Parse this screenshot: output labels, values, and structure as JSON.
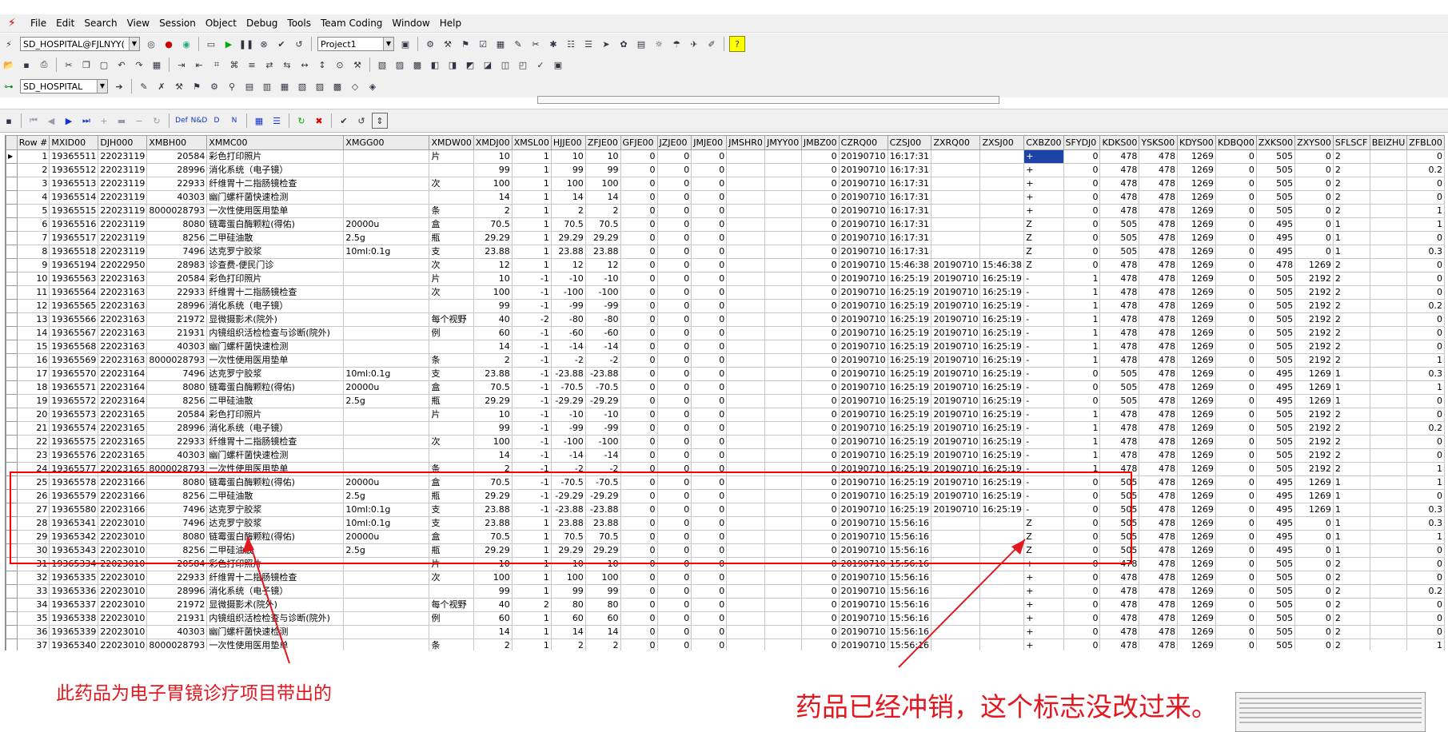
{
  "menu": [
    "File",
    "Edit",
    "Search",
    "View",
    "Session",
    "Object",
    "Debug",
    "Tools",
    "Team Coding",
    "Window",
    "Help"
  ],
  "toolbar": {
    "connection": "SD_HOSPITAL@FJLNYY(",
    "project": "Project1",
    "schema": "SD_HOSPITAL"
  },
  "grid": {
    "columns": [
      "Row #",
      "MXID00",
      "DJH000",
      "XMBH00",
      "XMMC00",
      "XMGG00",
      "XMDW00",
      "XMDJ00",
      "XMSL00",
      "HJJE00",
      "ZFJE00",
      "GFJE00",
      "JZJE00",
      "JMJE00",
      "JMSHR0",
      "JMYY00",
      "JMBZ00",
      "CZRQ00",
      "CZSJ00",
      "ZXRQ00",
      "ZXSJ00",
      "CXBZ00",
      "SFYDJ0",
      "KDKS00",
      "YSKS00",
      "KDYS00",
      "KDBQ00",
      "ZXKS00",
      "ZXYS00",
      "SFLSCF",
      "BEIZHU",
      "ZFBL00"
    ],
    "rows": [
      [
        "1",
        "19365511",
        "22023119",
        "20584",
        "彩色打印照片",
        "",
        "片",
        "10",
        "1",
        "10",
        "10",
        "0",
        "0",
        "0",
        "",
        "",
        "0",
        "20190710",
        "16:17:31",
        "",
        "",
        "+",
        "0",
        "478",
        "478",
        "1269",
        "0",
        "505",
        "0",
        "2",
        "",
        "0"
      ],
      [
        "2",
        "19365512",
        "22023119",
        "28996",
        "消化系统（电子镜）",
        "",
        "",
        "99",
        "1",
        "99",
        "99",
        "0",
        "0",
        "0",
        "",
        "",
        "0",
        "20190710",
        "16:17:31",
        "",
        "",
        "+",
        "0",
        "478",
        "478",
        "1269",
        "0",
        "505",
        "0",
        "2",
        "",
        "0.2"
      ],
      [
        "3",
        "19365513",
        "22023119",
        "22933",
        "纤维胃十二指肠镜检查",
        "",
        "次",
        "100",
        "1",
        "100",
        "100",
        "0",
        "0",
        "0",
        "",
        "",
        "0",
        "20190710",
        "16:17:31",
        "",
        "",
        "+",
        "0",
        "478",
        "478",
        "1269",
        "0",
        "505",
        "0",
        "2",
        "",
        "0"
      ],
      [
        "4",
        "19365514",
        "22023119",
        "40303",
        "幽门螺杆菌快速检测",
        "",
        "",
        "14",
        "1",
        "14",
        "14",
        "0",
        "0",
        "0",
        "",
        "",
        "0",
        "20190710",
        "16:17:31",
        "",
        "",
        "+",
        "0",
        "478",
        "478",
        "1269",
        "0",
        "505",
        "0",
        "2",
        "",
        "0"
      ],
      [
        "5",
        "19365515",
        "22023119",
        "8000028793",
        "一次性使用医用垫单",
        "",
        "条",
        "2",
        "1",
        "2",
        "2",
        "0",
        "0",
        "0",
        "",
        "",
        "0",
        "20190710",
        "16:17:31",
        "",
        "",
        "+",
        "0",
        "478",
        "478",
        "1269",
        "0",
        "505",
        "0",
        "2",
        "",
        "1"
      ],
      [
        "6",
        "19365516",
        "22023119",
        "8080",
        "链霉蛋白酶颗粒(得佑)",
        "20000u",
        "盒",
        "70.5",
        "1",
        "70.5",
        "70.5",
        "0",
        "0",
        "0",
        "",
        "",
        "0",
        "20190710",
        "16:17:31",
        "",
        "",
        "Z",
        "0",
        "505",
        "478",
        "1269",
        "0",
        "495",
        "0",
        "1",
        "",
        "1"
      ],
      [
        "7",
        "19365517",
        "22023119",
        "8256",
        "二甲硅油散",
        "2.5g",
        "瓶",
        "29.29",
        "1",
        "29.29",
        "29.29",
        "0",
        "0",
        "0",
        "",
        "",
        "0",
        "20190710",
        "16:17:31",
        "",
        "",
        "Z",
        "0",
        "505",
        "478",
        "1269",
        "0",
        "495",
        "0",
        "1",
        "",
        "0"
      ],
      [
        "8",
        "19365518",
        "22023119",
        "7496",
        "达克罗宁胶浆",
        "10ml:0.1g",
        "支",
        "23.88",
        "1",
        "23.88",
        "23.88",
        "0",
        "0",
        "0",
        "",
        "",
        "0",
        "20190710",
        "16:17:31",
        "",
        "",
        "Z",
        "0",
        "505",
        "478",
        "1269",
        "0",
        "495",
        "0",
        "1",
        "",
        "0.3"
      ],
      [
        "9",
        "19365194",
        "22022950",
        "28983",
        "诊查费-便民门诊",
        "",
        "次",
        "12",
        "1",
        "12",
        "12",
        "0",
        "0",
        "0",
        "",
        "",
        "0",
        "20190710",
        "15:46:38",
        "20190710",
        "15:46:38",
        "Z",
        "0",
        "478",
        "478",
        "1269",
        "0",
        "478",
        "1269",
        "2",
        "",
        "0"
      ],
      [
        "10",
        "19365563",
        "22023163",
        "20584",
        "彩色打印照片",
        "",
        "片",
        "10",
        "-1",
        "-10",
        "-10",
        "0",
        "0",
        "0",
        "",
        "",
        "0",
        "20190710",
        "16:25:19",
        "20190710",
        "16:25:19",
        "-",
        "1",
        "478",
        "478",
        "1269",
        "0",
        "505",
        "2192",
        "2",
        "",
        "0"
      ],
      [
        "11",
        "19365564",
        "22023163",
        "22933",
        "纤维胃十二指肠镜检查",
        "",
        "次",
        "100",
        "-1",
        "-100",
        "-100",
        "0",
        "0",
        "0",
        "",
        "",
        "0",
        "20190710",
        "16:25:19",
        "20190710",
        "16:25:19",
        "-",
        "1",
        "478",
        "478",
        "1269",
        "0",
        "505",
        "2192",
        "2",
        "",
        "0"
      ],
      [
        "12",
        "19365565",
        "22023163",
        "28996",
        "消化系统（电子镜）",
        "",
        "",
        "99",
        "-1",
        "-99",
        "-99",
        "0",
        "0",
        "0",
        "",
        "",
        "0",
        "20190710",
        "16:25:19",
        "20190710",
        "16:25:19",
        "-",
        "1",
        "478",
        "478",
        "1269",
        "0",
        "505",
        "2192",
        "2",
        "",
        "0.2"
      ],
      [
        "13",
        "19365566",
        "22023163",
        "21972",
        "显微摄影术(院外)",
        "",
        "每个视野",
        "40",
        "-2",
        "-80",
        "-80",
        "0",
        "0",
        "0",
        "",
        "",
        "0",
        "20190710",
        "16:25:19",
        "20190710",
        "16:25:19",
        "-",
        "1",
        "478",
        "478",
        "1269",
        "0",
        "505",
        "2192",
        "2",
        "",
        "0"
      ],
      [
        "14",
        "19365567",
        "22023163",
        "21931",
        "内镜组织活检检查与诊断(院外)",
        "",
        "例",
        "60",
        "-1",
        "-60",
        "-60",
        "0",
        "0",
        "0",
        "",
        "",
        "0",
        "20190710",
        "16:25:19",
        "20190710",
        "16:25:19",
        "-",
        "1",
        "478",
        "478",
        "1269",
        "0",
        "505",
        "2192",
        "2",
        "",
        "0"
      ],
      [
        "15",
        "19365568",
        "22023163",
        "40303",
        "幽门螺杆菌快速检测",
        "",
        "",
        "14",
        "-1",
        "-14",
        "-14",
        "0",
        "0",
        "0",
        "",
        "",
        "0",
        "20190710",
        "16:25:19",
        "20190710",
        "16:25:19",
        "-",
        "1",
        "478",
        "478",
        "1269",
        "0",
        "505",
        "2192",
        "2",
        "",
        "0"
      ],
      [
        "16",
        "19365569",
        "22023163",
        "8000028793",
        "一次性使用医用垫单",
        "",
        "条",
        "2",
        "-1",
        "-2",
        "-2",
        "0",
        "0",
        "0",
        "",
        "",
        "0",
        "20190710",
        "16:25:19",
        "20190710",
        "16:25:19",
        "-",
        "1",
        "478",
        "478",
        "1269",
        "0",
        "505",
        "2192",
        "2",
        "",
        "1"
      ],
      [
        "17",
        "19365570",
        "22023164",
        "7496",
        "达克罗宁胶浆",
        "10ml:0.1g",
        "支",
        "23.88",
        "-1",
        "-23.88",
        "-23.88",
        "0",
        "0",
        "0",
        "",
        "",
        "0",
        "20190710",
        "16:25:19",
        "20190710",
        "16:25:19",
        "-",
        "0",
        "505",
        "478",
        "1269",
        "0",
        "495",
        "1269",
        "1",
        "",
        "0.3"
      ],
      [
        "18",
        "19365571",
        "22023164",
        "8080",
        "链霉蛋白酶颗粒(得佑)",
        "20000u",
        "盒",
        "70.5",
        "-1",
        "-70.5",
        "-70.5",
        "0",
        "0",
        "0",
        "",
        "",
        "0",
        "20190710",
        "16:25:19",
        "20190710",
        "16:25:19",
        "-",
        "0",
        "505",
        "478",
        "1269",
        "0",
        "495",
        "1269",
        "1",
        "",
        "1"
      ],
      [
        "19",
        "19365572",
        "22023164",
        "8256",
        "二甲硅油散",
        "2.5g",
        "瓶",
        "29.29",
        "-1",
        "-29.29",
        "-29.29",
        "0",
        "0",
        "0",
        "",
        "",
        "0",
        "20190710",
        "16:25:19",
        "20190710",
        "16:25:19",
        "-",
        "0",
        "505",
        "478",
        "1269",
        "0",
        "495",
        "1269",
        "1",
        "",
        "0"
      ],
      [
        "20",
        "19365573",
        "22023165",
        "20584",
        "彩色打印照片",
        "",
        "片",
        "10",
        "-1",
        "-10",
        "-10",
        "0",
        "0",
        "0",
        "",
        "",
        "0",
        "20190710",
        "16:25:19",
        "20190710",
        "16:25:19",
        "-",
        "1",
        "478",
        "478",
        "1269",
        "0",
        "505",
        "2192",
        "2",
        "",
        "0"
      ],
      [
        "21",
        "19365574",
        "22023165",
        "28996",
        "消化系统（电子镜）",
        "",
        "",
        "99",
        "-1",
        "-99",
        "-99",
        "0",
        "0",
        "0",
        "",
        "",
        "0",
        "20190710",
        "16:25:19",
        "20190710",
        "16:25:19",
        "-",
        "1",
        "478",
        "478",
        "1269",
        "0",
        "505",
        "2192",
        "2",
        "",
        "0.2"
      ],
      [
        "22",
        "19365575",
        "22023165",
        "22933",
        "纤维胃十二指肠镜检查",
        "",
        "次",
        "100",
        "-1",
        "-100",
        "-100",
        "0",
        "0",
        "0",
        "",
        "",
        "0",
        "20190710",
        "16:25:19",
        "20190710",
        "16:25:19",
        "-",
        "1",
        "478",
        "478",
        "1269",
        "0",
        "505",
        "2192",
        "2",
        "",
        "0"
      ],
      [
        "23",
        "19365576",
        "22023165",
        "40303",
        "幽门螺杆菌快速检测",
        "",
        "",
        "14",
        "-1",
        "-14",
        "-14",
        "0",
        "0",
        "0",
        "",
        "",
        "0",
        "20190710",
        "16:25:19",
        "20190710",
        "16:25:19",
        "-",
        "1",
        "478",
        "478",
        "1269",
        "0",
        "505",
        "2192",
        "2",
        "",
        "0"
      ],
      [
        "24",
        "19365577",
        "22023165",
        "8000028793",
        "一次性使用医用垫单",
        "",
        "条",
        "2",
        "-1",
        "-2",
        "-2",
        "0",
        "0",
        "0",
        "",
        "",
        "0",
        "20190710",
        "16:25:19",
        "20190710",
        "16:25:19",
        "-",
        "1",
        "478",
        "478",
        "1269",
        "0",
        "505",
        "2192",
        "2",
        "",
        "1"
      ],
      [
        "25",
        "19365578",
        "22023166",
        "8080",
        "链霉蛋白酶颗粒(得佑)",
        "20000u",
        "盒",
        "70.5",
        "-1",
        "-70.5",
        "-70.5",
        "0",
        "0",
        "0",
        "",
        "",
        "0",
        "20190710",
        "16:25:19",
        "20190710",
        "16:25:19",
        "-",
        "0",
        "505",
        "478",
        "1269",
        "0",
        "495",
        "1269",
        "1",
        "",
        "1"
      ],
      [
        "26",
        "19365579",
        "22023166",
        "8256",
        "二甲硅油散",
        "2.5g",
        "瓶",
        "29.29",
        "-1",
        "-29.29",
        "-29.29",
        "0",
        "0",
        "0",
        "",
        "",
        "0",
        "20190710",
        "16:25:19",
        "20190710",
        "16:25:19",
        "-",
        "0",
        "505",
        "478",
        "1269",
        "0",
        "495",
        "1269",
        "1",
        "",
        "0"
      ],
      [
        "27",
        "19365580",
        "22023166",
        "7496",
        "达克罗宁胶浆",
        "10ml:0.1g",
        "支",
        "23.88",
        "-1",
        "-23.88",
        "-23.88",
        "0",
        "0",
        "0",
        "",
        "",
        "0",
        "20190710",
        "16:25:19",
        "20190710",
        "16:25:19",
        "-",
        "0",
        "505",
        "478",
        "1269",
        "0",
        "495",
        "1269",
        "1",
        "",
        "0.3"
      ],
      [
        "28",
        "19365341",
        "22023010",
        "7496",
        "达克罗宁胶浆",
        "10ml:0.1g",
        "支",
        "23.88",
        "1",
        "23.88",
        "23.88",
        "0",
        "0",
        "0",
        "",
        "",
        "0",
        "20190710",
        "15:56:16",
        "",
        "",
        "Z",
        "0",
        "505",
        "478",
        "1269",
        "0",
        "495",
        "0",
        "1",
        "",
        "0.3"
      ],
      [
        "29",
        "19365342",
        "22023010",
        "8080",
        "链霉蛋白酶颗粒(得佑)",
        "20000u",
        "盒",
        "70.5",
        "1",
        "70.5",
        "70.5",
        "0",
        "0",
        "0",
        "",
        "",
        "0",
        "20190710",
        "15:56:16",
        "",
        "",
        "Z",
        "0",
        "505",
        "478",
        "1269",
        "0",
        "495",
        "0",
        "1",
        "",
        "1"
      ],
      [
        "30",
        "19365343",
        "22023010",
        "8256",
        "二甲硅油散",
        "2.5g",
        "瓶",
        "29.29",
        "1",
        "29.29",
        "29.29",
        "0",
        "0",
        "0",
        "",
        "",
        "0",
        "20190710",
        "15:56:16",
        "",
        "",
        "Z",
        "0",
        "505",
        "478",
        "1269",
        "0",
        "495",
        "0",
        "1",
        "",
        "0"
      ],
      [
        "31",
        "19365334",
        "22023010",
        "20584",
        "彩色打印照片",
        "",
        "片",
        "10",
        "1",
        "10",
        "10",
        "0",
        "0",
        "0",
        "",
        "",
        "0",
        "20190710",
        "15:56:16",
        "",
        "",
        "+",
        "0",
        "478",
        "478",
        "1269",
        "0",
        "505",
        "0",
        "2",
        "",
        "0"
      ],
      [
        "32",
        "19365335",
        "22023010",
        "22933",
        "纤维胃十二指肠镜检查",
        "",
        "次",
        "100",
        "1",
        "100",
        "100",
        "0",
        "0",
        "0",
        "",
        "",
        "0",
        "20190710",
        "15:56:16",
        "",
        "",
        "+",
        "0",
        "478",
        "478",
        "1269",
        "0",
        "505",
        "0",
        "2",
        "",
        "0"
      ],
      [
        "33",
        "19365336",
        "22023010",
        "28996",
        "消化系统（电子镜）",
        "",
        "",
        "99",
        "1",
        "99",
        "99",
        "0",
        "0",
        "0",
        "",
        "",
        "0",
        "20190710",
        "15:56:16",
        "",
        "",
        "+",
        "0",
        "478",
        "478",
        "1269",
        "0",
        "505",
        "0",
        "2",
        "",
        "0.2"
      ],
      [
        "34",
        "19365337",
        "22023010",
        "21972",
        "显微摄影术(院外)",
        "",
        "每个视野",
        "40",
        "2",
        "80",
        "80",
        "0",
        "0",
        "0",
        "",
        "",
        "0",
        "20190710",
        "15:56:16",
        "",
        "",
        "+",
        "0",
        "478",
        "478",
        "1269",
        "0",
        "505",
        "0",
        "2",
        "",
        "0"
      ],
      [
        "35",
        "19365338",
        "22023010",
        "21931",
        "内镜组织活检检查与诊断(院外)",
        "",
        "例",
        "60",
        "1",
        "60",
        "60",
        "0",
        "0",
        "0",
        "",
        "",
        "0",
        "20190710",
        "15:56:16",
        "",
        "",
        "+",
        "0",
        "478",
        "478",
        "1269",
        "0",
        "505",
        "0",
        "2",
        "",
        "0"
      ],
      [
        "36",
        "19365339",
        "22023010",
        "40303",
        "幽门螺杆菌快速检测",
        "",
        "",
        "14",
        "1",
        "14",
        "14",
        "0",
        "0",
        "0",
        "",
        "",
        "0",
        "20190710",
        "15:56:16",
        "",
        "",
        "+",
        "0",
        "478",
        "478",
        "1269",
        "0",
        "505",
        "0",
        "2",
        "",
        "0"
      ],
      [
        "37",
        "19365340",
        "22023010",
        "8000028793",
        "一次性使用医用垫单",
        "",
        "条",
        "2",
        "1",
        "2",
        "2",
        "0",
        "0",
        "0",
        "",
        "",
        "0",
        "20190710",
        "15:56:16",
        "",
        "",
        "+",
        "0",
        "478",
        "478",
        "1269",
        "0",
        "505",
        "0",
        "2",
        "",
        "1"
      ]
    ]
  },
  "annotations": {
    "left": "此药品为电子胃镜诊疗项目带出的",
    "right": "药品已经冲销，这个标志没改过来。"
  },
  "colors": {
    "annotation": "#e3171f",
    "selection": "#1c44a8"
  }
}
